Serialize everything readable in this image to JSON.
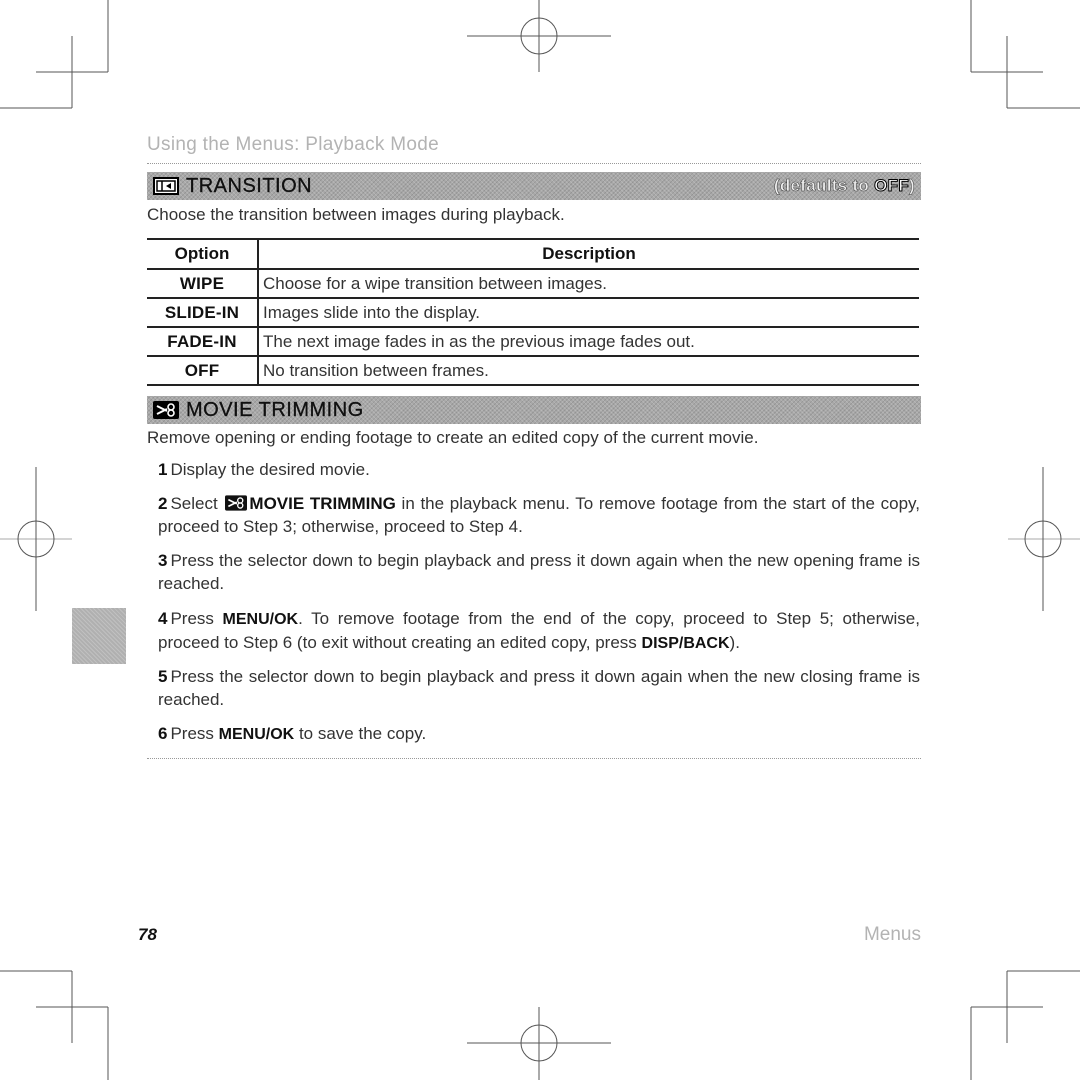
{
  "running_head": "Using the Menus: Playback Mode",
  "transition": {
    "icon": "transition-icon",
    "title": "TRANSITION",
    "defaults_prefix": "(defaults to ",
    "defaults_value": "OFF",
    "defaults_suffix": ")",
    "intro": "Choose the transition between images during playback.",
    "table": {
      "headers": [
        "Option",
        "Description"
      ],
      "rows": [
        {
          "option": "WIPE",
          "description": "Choose for a wipe transition between images."
        },
        {
          "option": "SLIDE-IN",
          "description": "Images slide into the display."
        },
        {
          "option": "FADE-IN",
          "description": "The next image fades in as the previous image fades out."
        },
        {
          "option": "OFF",
          "description": "No transition between frames."
        }
      ]
    }
  },
  "movie_trimming": {
    "icon": "scissors-icon",
    "title": "MOVIE TRIMMING",
    "intro": "Remove opening or ending footage to create an edited copy of the current movie.",
    "steps": [
      {
        "num": "1",
        "text": "Display the desired movie."
      },
      {
        "num": "2",
        "pre": "Select ",
        "bold": "MOVIE TRIMMING",
        "post": " in the playback menu. To remove footage from the start of the copy, proceed to Step 3; otherwise, proceed to Step 4."
      },
      {
        "num": "3",
        "text": "Press the selector down to begin playback and press it down again when the new opening frame is reached."
      },
      {
        "num": "4",
        "pre": "Press ",
        "key1": "MENU/OK",
        "mid": ". To remove footage from the end of the copy, proceed to Step 5; otherwise, proceed to Step 6 (to exit without creating an edited copy, press ",
        "key2": "DISP/BACK",
        "post": ")."
      },
      {
        "num": "5",
        "text": "Press the selector down to begin playback and press it down again when the new closing frame is reached."
      },
      {
        "num": "6",
        "pre": "Press ",
        "key1": "MENU/OK",
        "post": " to save the copy."
      }
    ]
  },
  "footer": {
    "page_number": "78",
    "section_label": "Menus"
  }
}
